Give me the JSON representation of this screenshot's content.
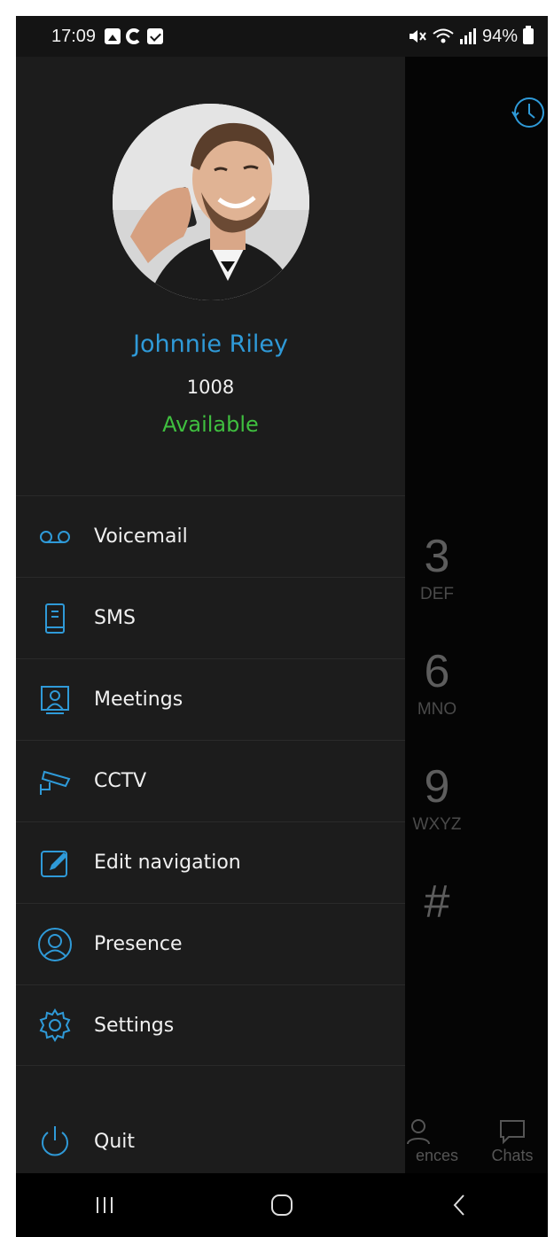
{
  "status_bar": {
    "time": "17:09",
    "battery": "94%",
    "icons": [
      "gallery-icon",
      "google-icon",
      "check-icon",
      "mute-icon",
      "wifi-icon",
      "signal-icon",
      "battery-icon"
    ]
  },
  "dialer": {
    "keys": [
      {
        "num": "3",
        "letters": "DEF"
      },
      {
        "num": "6",
        "letters": "MNO"
      },
      {
        "num": "9",
        "letters": "WXYZ"
      },
      {
        "num": "#",
        "letters": ""
      }
    ],
    "tabs": [
      {
        "label": "ences",
        "icon": "person-icon"
      },
      {
        "label": "Chats",
        "icon": "chat-icon"
      }
    ]
  },
  "profile": {
    "name": "Johnnie Riley",
    "extension": "1008",
    "status": "Available"
  },
  "menu": [
    {
      "label": "Voicemail",
      "icon": "voicemail-icon"
    },
    {
      "label": "SMS",
      "icon": "sms-icon"
    },
    {
      "label": "Meetings",
      "icon": "meetings-icon"
    },
    {
      "label": "CCTV",
      "icon": "cctv-icon"
    },
    {
      "label": "Edit navigation",
      "icon": "edit-icon"
    },
    {
      "label": "Presence",
      "icon": "presence-icon"
    },
    {
      "label": "Settings",
      "icon": "settings-icon"
    }
  ],
  "quit": {
    "label": "Quit",
    "icon": "power-icon"
  },
  "colors": {
    "accent": "#2f9ad8",
    "status_available": "#3fbf3f",
    "drawer_bg": "#1c1c1c"
  }
}
